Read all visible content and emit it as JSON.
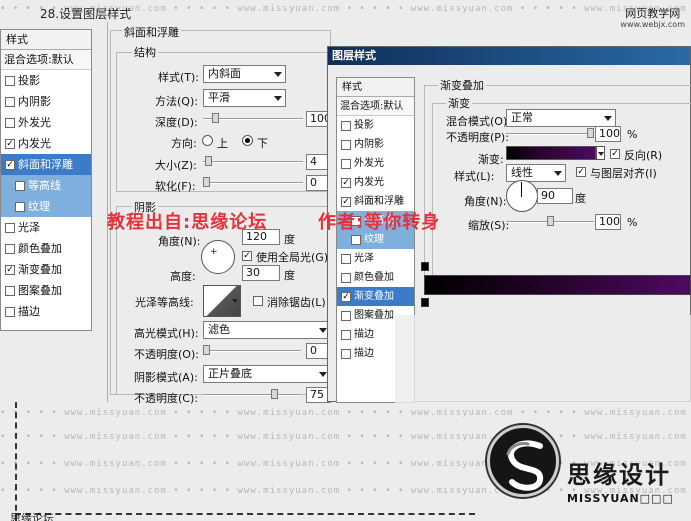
{
  "caption": "28.设置图层样式",
  "site": {
    "name": "网页教学网",
    "url": "www.webjx.com"
  },
  "watermark": "missyuan.com",
  "styles": {
    "header": "样式",
    "blend": "混合选项:默认",
    "items": [
      {
        "label": "投影",
        "checked": false
      },
      {
        "label": "内阴影",
        "checked": false
      },
      {
        "label": "外发光",
        "checked": false
      },
      {
        "label": "内发光",
        "checked": true
      },
      {
        "label": "斜面和浮雕",
        "checked": true,
        "selected": true
      },
      {
        "label": "等高线",
        "checked": false,
        "sub": true
      },
      {
        "label": "纹理",
        "checked": false,
        "sub": true
      },
      {
        "label": "光泽",
        "checked": false
      },
      {
        "label": "颜色叠加",
        "checked": false
      },
      {
        "label": "渐变叠加",
        "checked": true
      },
      {
        "label": "图案叠加",
        "checked": false
      },
      {
        "label": "描边",
        "checked": false
      }
    ]
  },
  "bevel": {
    "title": "斜面和浮雕",
    "structure": "结构",
    "style_label": "样式(T):",
    "style_value": "内斜面",
    "technique_label": "方法(Q):",
    "technique_value": "平滑",
    "depth_label": "深度(D):",
    "depth_value": "100",
    "depth_fraction": 0.1,
    "direction_label": "方向:",
    "dir_up": "上",
    "dir_down": "下",
    "size_label": "大小(Z):",
    "size_value": "4",
    "size_fraction": 0.02,
    "soften_label": "软化(F):",
    "soften_value": "0",
    "soften_fraction": 0.0,
    "shading": "阴影",
    "angle_label": "角度(N):",
    "angle_value": "120",
    "degree": "度",
    "global_light": "使用全局光(G)",
    "altitude_label": "高度:",
    "altitude_value": "30",
    "gloss_label": "光泽等高线:",
    "antialias": "消除锯齿(L)",
    "highlight_label": "高光模式(H):",
    "highlight_value": "滤色",
    "highlight_color": "#ffffff",
    "hl_opacity_label": "不透明度(O):",
    "hl_opacity_value": "0",
    "hl_opacity_fraction": 0.0,
    "percent": "%",
    "shadow_label": "阴影模式(A):",
    "shadow_value": "正片叠底",
    "shadow_color": "#000000",
    "sh_opacity_label": "不透明度(C):",
    "sh_opacity_value": "75",
    "sh_opacity_fraction": 0.75
  },
  "credit_left": "教程出自:思缘论坛",
  "credit_right": "作者:等你转身",
  "dialog": {
    "title": "图层样式",
    "list_header": "样式",
    "list_blend": "混合选项:默认",
    "list_items": [
      {
        "label": "投影",
        "checked": false
      },
      {
        "label": "内阴影",
        "checked": false
      },
      {
        "label": "外发光",
        "checked": false
      },
      {
        "label": "内发光",
        "checked": true
      },
      {
        "label": "斜面和浮雕",
        "checked": true
      },
      {
        "label": "等高线",
        "checked": false,
        "sub": true
      },
      {
        "label": "纹理",
        "checked": false,
        "sub": true
      },
      {
        "label": "光泽",
        "checked": false
      },
      {
        "label": "颜色叠加",
        "checked": false
      },
      {
        "label": "渐变叠加",
        "checked": true,
        "selected": true
      },
      {
        "label": "图案叠加",
        "checked": false
      },
      {
        "label": "描边",
        "checked": false
      },
      {
        "label": "描边",
        "checked": false
      }
    ],
    "gradient_overlay": {
      "title": "渐变叠加",
      "group": "渐变",
      "blend_label": "混合模式(O):",
      "blend_value": "正常",
      "opacity_label": "不透明度(P):",
      "opacity_value": "100",
      "opacity_fraction": 1.0,
      "percent": "%",
      "gradient_label": "渐变:",
      "reverse": "反向(R)",
      "style_label": "样式(L):",
      "style_value": "线性",
      "align": "与图层对齐(I)",
      "angle_label": "角度(N):",
      "angle_value": "90",
      "degree": "度",
      "scale_label": "缩放(S):",
      "scale_value": "100",
      "scale_fraction": 0.5,
      "colors": {
        "start": "#000000",
        "end": "#4e0a62"
      }
    }
  },
  "logo": {
    "cn": "思缘设计",
    "en": "MISSYUAN□□□"
  },
  "bottom_text": "思缘论坛"
}
